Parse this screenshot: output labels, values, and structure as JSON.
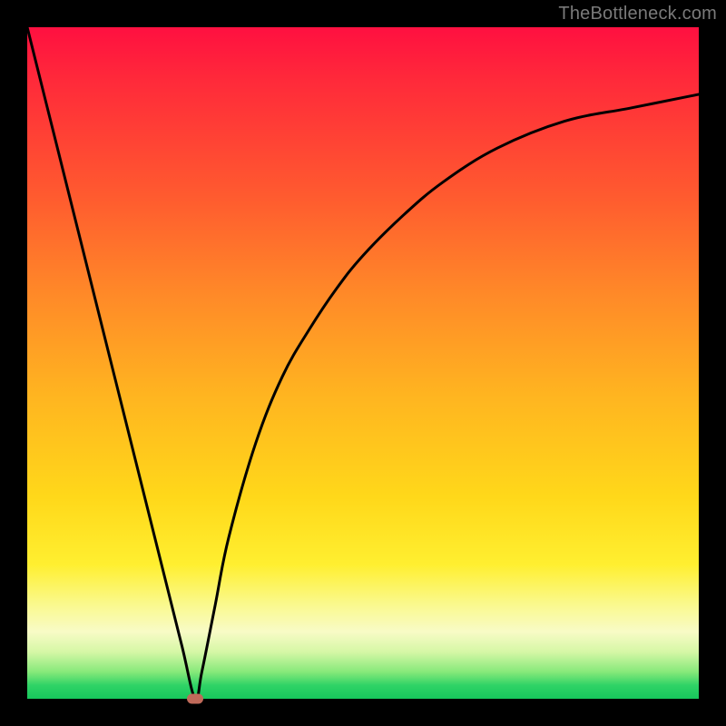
{
  "watermark": "TheBottleneck.com",
  "colors": {
    "frame_bg": "#000000",
    "curve": "#000000",
    "marker": "#c06a5a",
    "gradient_top": "#ff1040",
    "gradient_bottom": "#17c75c"
  },
  "chart_data": {
    "type": "line",
    "title": "",
    "xlabel": "",
    "ylabel": "",
    "xlim": [
      0,
      100
    ],
    "ylim": [
      0,
      100
    ],
    "notes": "No axis ticks or labels are visible. x/y are normalized 0–100. A black curve drops steeply from top-left to a minimum near x≈25, y≈0, then rises with decreasing slope toward the top-right. A small rounded marker highlights the minimum.",
    "series": [
      {
        "name": "curve",
        "x": [
          0,
          4,
          8,
          12,
          16,
          20,
          23,
          25,
          26,
          28,
          30,
          34,
          38,
          42,
          46,
          50,
          56,
          62,
          70,
          80,
          90,
          100
        ],
        "y": [
          100,
          84,
          68,
          52,
          36,
          20,
          8,
          0,
          4,
          14,
          24,
          38,
          48,
          55,
          61,
          66,
          72,
          77,
          82,
          86,
          88,
          90
        ]
      }
    ],
    "marker": {
      "x": 25,
      "y": 0
    }
  }
}
